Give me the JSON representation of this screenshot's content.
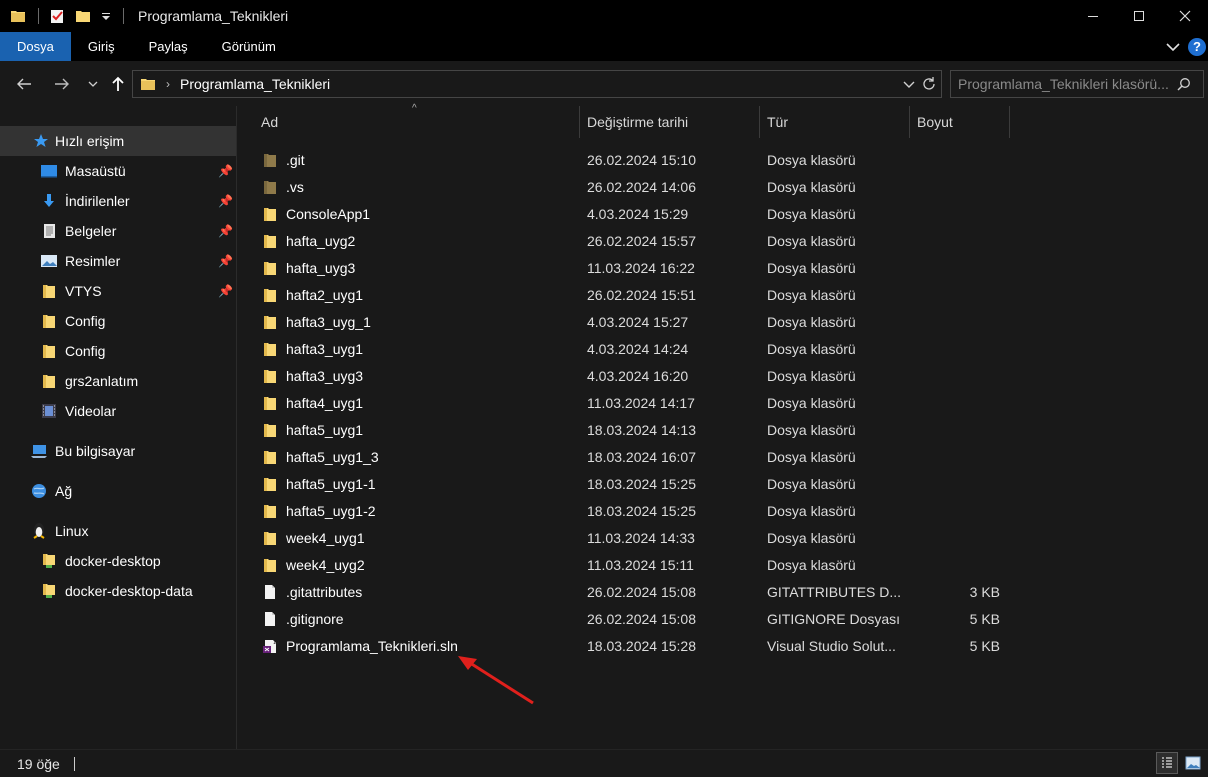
{
  "window": {
    "title": "Programlama_Teknikleri",
    "minimize": "—",
    "maximize": "☐",
    "close": "✕"
  },
  "ribbon": {
    "tabs": [
      {
        "label": "Dosya"
      },
      {
        "label": "Giriş"
      },
      {
        "label": "Paylaş"
      },
      {
        "label": "Görünüm"
      }
    ],
    "expand": "⌄",
    "help": "?"
  },
  "nav": {
    "back": "←",
    "forward": "→",
    "recent": "⌄",
    "up": "↑",
    "path": "Programlama_Teknikleri",
    "crumb_sep": "›",
    "address_dropdown": "⌄",
    "refresh": "↻",
    "search_placeholder": "Programlama_Teknikleri klasörü..."
  },
  "sidebar": {
    "items": [
      {
        "label": "Hızlı erişim",
        "icon": "star-icon",
        "pinned": false
      },
      {
        "label": "Masaüstü",
        "icon": "desktop-icon",
        "pinned": true
      },
      {
        "label": "İndirilenler",
        "icon": "download-icon",
        "pinned": true
      },
      {
        "label": "Belgeler",
        "icon": "documents-icon",
        "pinned": true
      },
      {
        "label": "Resimler",
        "icon": "pictures-icon",
        "pinned": true
      },
      {
        "label": "VTYS",
        "icon": "folder-icon",
        "pinned": true
      },
      {
        "label": "Config",
        "icon": "folder-icon",
        "pinned": false
      },
      {
        "label": "Config",
        "icon": "folder-icon",
        "pinned": false
      },
      {
        "label": "grs2anlatım",
        "icon": "folder-icon",
        "pinned": false
      },
      {
        "label": "Videolar",
        "icon": "videos-icon",
        "pinned": false
      },
      {
        "label": "Bu bilgisayar",
        "icon": "computer-icon",
        "pinned": false
      },
      {
        "label": "Ağ",
        "icon": "network-icon",
        "pinned": false
      },
      {
        "label": "Linux",
        "icon": "linux-icon",
        "pinned": false
      },
      {
        "label": "docker-desktop",
        "icon": "network-folder-icon",
        "pinned": false
      },
      {
        "label": "docker-desktop-data",
        "icon": "network-folder-icon",
        "pinned": false
      }
    ]
  },
  "columns": {
    "name": "Ad",
    "date": "Değiştirme tarihi",
    "type": "Tür",
    "size": "Boyut",
    "sort_indicator": "^"
  },
  "files": [
    {
      "name": ".git",
      "date": "26.02.2024 15:10",
      "type": "Dosya klasörü",
      "size": "",
      "icon": "hidden-folder-icon"
    },
    {
      "name": ".vs",
      "date": "26.02.2024 14:06",
      "type": "Dosya klasörü",
      "size": "",
      "icon": "hidden-folder-icon"
    },
    {
      "name": "ConsoleApp1",
      "date": "4.03.2024 15:29",
      "type": "Dosya klasörü",
      "size": "",
      "icon": "folder-icon"
    },
    {
      "name": "hafta_uyg2",
      "date": "26.02.2024 15:57",
      "type": "Dosya klasörü",
      "size": "",
      "icon": "folder-icon"
    },
    {
      "name": "hafta_uyg3",
      "date": "11.03.2024 16:22",
      "type": "Dosya klasörü",
      "size": "",
      "icon": "folder-icon"
    },
    {
      "name": "hafta2_uyg1",
      "date": "26.02.2024 15:51",
      "type": "Dosya klasörü",
      "size": "",
      "icon": "folder-icon"
    },
    {
      "name": "hafta3_uyg_1",
      "date": "4.03.2024 15:27",
      "type": "Dosya klasörü",
      "size": "",
      "icon": "folder-icon"
    },
    {
      "name": "hafta3_uyg1",
      "date": "4.03.2024 14:24",
      "type": "Dosya klasörü",
      "size": "",
      "icon": "folder-icon"
    },
    {
      "name": "hafta3_uyg3",
      "date": "4.03.2024 16:20",
      "type": "Dosya klasörü",
      "size": "",
      "icon": "folder-icon"
    },
    {
      "name": "hafta4_uyg1",
      "date": "11.03.2024 14:17",
      "type": "Dosya klasörü",
      "size": "",
      "icon": "folder-icon"
    },
    {
      "name": "hafta5_uyg1",
      "date": "18.03.2024 14:13",
      "type": "Dosya klasörü",
      "size": "",
      "icon": "folder-icon"
    },
    {
      "name": "hafta5_uyg1_3",
      "date": "18.03.2024 16:07",
      "type": "Dosya klasörü",
      "size": "",
      "icon": "folder-icon"
    },
    {
      "name": "hafta5_uyg1-1",
      "date": "18.03.2024 15:25",
      "type": "Dosya klasörü",
      "size": "",
      "icon": "folder-icon"
    },
    {
      "name": "hafta5_uyg1-2",
      "date": "18.03.2024 15:25",
      "type": "Dosya klasörü",
      "size": "",
      "icon": "folder-icon"
    },
    {
      "name": "week4_uyg1",
      "date": "11.03.2024 14:33",
      "type": "Dosya klasörü",
      "size": "",
      "icon": "folder-icon"
    },
    {
      "name": "week4_uyg2",
      "date": "11.03.2024 15:11",
      "type": "Dosya klasörü",
      "size": "",
      "icon": "folder-icon"
    },
    {
      "name": ".gitattributes",
      "date": "26.02.2024 15:08",
      "type": "GITATTRIBUTES D...",
      "size": "3 KB",
      "icon": "file-icon"
    },
    {
      "name": ".gitignore",
      "date": "26.02.2024 15:08",
      "type": "GITIGNORE Dosyası",
      "size": "5 KB",
      "icon": "file-icon"
    },
    {
      "name": "Programlama_Teknikleri.sln",
      "date": "18.03.2024 15:28",
      "type": "Visual Studio Solut...",
      "size": "5 KB",
      "icon": "vs-solution-icon"
    }
  ],
  "status": {
    "count": "19 öğe"
  },
  "colors": {
    "folder": "#f8d775",
    "hidden_folder": "#9c8550",
    "accent": "#1a62b0",
    "annotation_arrow": "#e0201c"
  }
}
